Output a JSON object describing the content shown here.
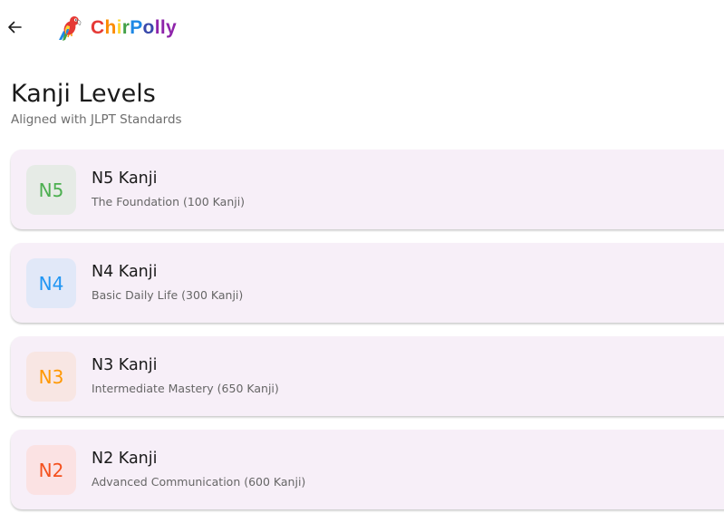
{
  "app": {
    "name_parts": [
      {
        "text": "C",
        "color": "#e53935"
      },
      {
        "text": "h",
        "color": "#fb8c00"
      },
      {
        "text": "i",
        "color": "#fdd835"
      },
      {
        "text": "r",
        "color": "#43a047"
      },
      {
        "text": "P",
        "color": "#1e88e5"
      },
      {
        "text": "o",
        "color": "#3949ab"
      },
      {
        "text": "l",
        "color": "#8e24aa"
      },
      {
        "text": "l",
        "color": "#8e24aa"
      },
      {
        "text": "y",
        "color": "#8e24aa"
      }
    ]
  },
  "header": {
    "back_icon": "arrow-left-icon",
    "logo_icon": "parrot-icon"
  },
  "page": {
    "title": "Kanji Levels",
    "subtitle": "Aligned with JLPT Standards"
  },
  "levels": [
    {
      "badge": "N5",
      "name": "N5 Kanji",
      "description": "The Foundation (100 Kanji)",
      "badge_color": "#4caf50",
      "badge_bg": "#e6ebe6"
    },
    {
      "badge": "N4",
      "name": "N4 Kanji",
      "description": "Basic Daily Life (300 Kanji)",
      "badge_color": "#2196f3",
      "badge_bg": "#e1e8f8"
    },
    {
      "badge": "N3",
      "name": "N3 Kanji",
      "description": "Intermediate Mastery (650 Kanji)",
      "badge_color": "#ff9800",
      "badge_bg": "#f8e6e3"
    },
    {
      "badge": "N2",
      "name": "N2 Kanji",
      "description": "Advanced Communication (600 Kanji)",
      "badge_color": "#f4511e",
      "badge_bg": "#fbe2e3"
    }
  ]
}
